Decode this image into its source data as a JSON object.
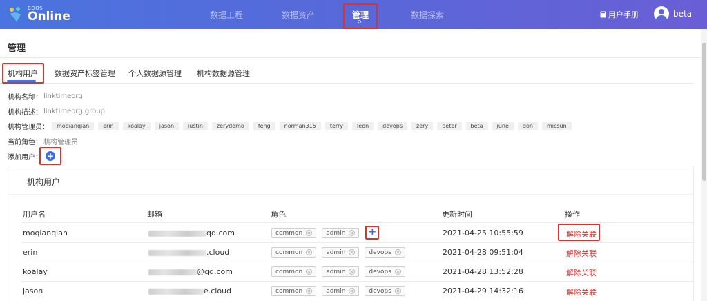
{
  "header": {
    "logo_small": "BDOS",
    "logo_big": "Online",
    "nav": [
      "数据工程",
      "数据资产",
      "管理",
      "数据探索"
    ],
    "manual": "用户手册",
    "username": "beta"
  },
  "page": {
    "title": "管理",
    "tabs": [
      "机构用户",
      "数据资产标签管理",
      "个人数据源管理",
      "机构数据源管理"
    ]
  },
  "org": {
    "name_label": "机构名称：",
    "name_value": "linktimeorg",
    "desc_label": "机构描述：",
    "desc_value": "linktimeorg group",
    "admins_label": "机构管理员：",
    "admins": [
      "moqianqian",
      "erin",
      "koalay",
      "jason",
      "justin",
      "zerydemo",
      "feng",
      "norman315",
      "terry",
      "leon",
      "devops",
      "zery",
      "peter",
      "beta",
      "june",
      "don",
      "micsun"
    ],
    "role_label": "当前角色：",
    "role_value": "机构管理员",
    "add_user_label": "添加用户："
  },
  "users_card": {
    "title": "机构用户",
    "columns": [
      "用户名",
      "邮箱",
      "角色",
      "更新时间",
      "操作"
    ],
    "rows": [
      {
        "username": "moqianqian",
        "email_visible": "qq.com",
        "roles": [
          "common",
          "admin"
        ],
        "updated": "2021-04-25 10:55:59",
        "action": "解除关联"
      },
      {
        "username": "erin",
        "email_visible": ".cloud",
        "roles": [
          "common",
          "admin",
          "devops"
        ],
        "updated": "2021-04-28 09:51:04",
        "action": "解除关联"
      },
      {
        "username": "koalay",
        "email_visible": "@qq.com",
        "roles": [
          "common",
          "admin",
          "devops"
        ],
        "updated": "2021-04-28 13:52:28",
        "action": "解除关联"
      },
      {
        "username": "jason",
        "email_visible": "e.cloud",
        "roles": [
          "common",
          "admin",
          "devops"
        ],
        "updated": "2021-04-29 14:32:16",
        "action": "解除关联"
      }
    ]
  },
  "colors": {
    "accent": "#4a74e0",
    "highlight": "#e0302b",
    "danger_link": "#e0302b"
  }
}
